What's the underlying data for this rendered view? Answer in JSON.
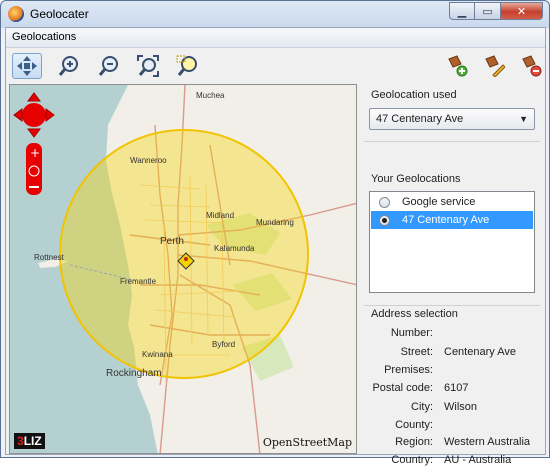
{
  "window": {
    "title": "Geolocater"
  },
  "window_controls": {
    "minimize": "▁",
    "maximize": "▭",
    "close": "✕"
  },
  "menu": {
    "items": [
      "Geolocations"
    ]
  },
  "toolbar": {
    "left_tools": [
      "pan-arrows-icon",
      "zoom-in-icon",
      "zoom-out-icon",
      "zoom-extent-icon",
      "zoom-selection-icon"
    ],
    "right_tools": [
      "add-location-icon",
      "edit-location-icon",
      "remove-location-icon"
    ]
  },
  "map": {
    "attribution": "OpenStreetMap",
    "logo_part1": "3",
    "logo_part2": "LIZ",
    "place_labels": [
      "Muchea",
      "Wanneroo",
      "Midland",
      "Mundaring",
      "Perth",
      "Kalamunda",
      "Rottnest",
      "Fremantle",
      "Byford",
      "Kwinana",
      "Rockingham"
    ]
  },
  "sidebar": {
    "geolocation_used_title": "Geolocation used",
    "geolocation_used_value": "47 Centenary Ave",
    "your_geolocations_title": "Your Geolocations",
    "geolocations": [
      {
        "label": "Google service",
        "selected": false
      },
      {
        "label": "47 Centenary Ave",
        "selected": true
      }
    ],
    "address_title": "Address selection",
    "address": [
      {
        "label": "Number:",
        "value": ""
      },
      {
        "label": "Street:",
        "value": "Centenary Ave"
      },
      {
        "label": "Premises:",
        "value": ""
      },
      {
        "label": "Postal code:",
        "value": "6107"
      },
      {
        "label": "City:",
        "value": "Wilson"
      },
      {
        "label": "County:",
        "value": ""
      },
      {
        "label": "Region:",
        "value": "Western Australia"
      },
      {
        "label": "Country:",
        "value": "AU - Australia"
      }
    ]
  },
  "colors": {
    "accent": "#3399ff",
    "circle": "#f6d400",
    "ocean": "#b5d0d0",
    "land": "#f2efe9",
    "nav_red": "#e60000"
  }
}
